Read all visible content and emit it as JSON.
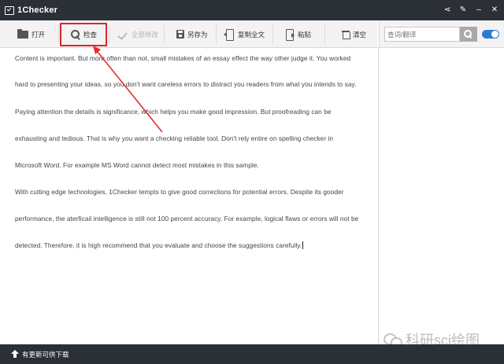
{
  "app": {
    "title": "1Checker"
  },
  "window_controls": [
    {
      "name": "share-icon",
      "glyph": "⋖"
    },
    {
      "name": "edit-icon",
      "glyph": "✎"
    },
    {
      "name": "minimize-icon",
      "glyph": "–"
    },
    {
      "name": "close-icon",
      "glyph": "✕"
    }
  ],
  "toolbar": {
    "open_label": "打开",
    "check_label": "检查",
    "accept_all_label": "全部修改",
    "save_as_label": "另存为",
    "copy_all_label": "复制全文",
    "paste_label": "粘贴",
    "clear_label": "清空"
  },
  "search": {
    "placeholder": "查词/翻译"
  },
  "editor": {
    "lines": [
      "Content is important. But more often than not, small mistakes of an essay effect the way other judge it. You worked",
      "hard to presenting your ideas, so you don't want careless errors to distract you readers from what you intends to say.",
      "Paying attention the details is significance, which helps you make good impression. But proofreading can be",
      "exhausting and tedious. That is why you want a checking reliable tool. Don't rely entire on spelling checker in",
      "Microsoft Word. For example MS Word cannot detect most mistakes in this sample.",
      "With cutting edge technologies, 1Checker tempts to give good corrections for potential errors. Despite its gooder",
      "performance, the aterficail intelligence is still not 100 percent accuracy. For example, logical flaws or errors will not be",
      "detected. Therefore, it is high    recommend that you evaluate and choose the suggestions carefully."
    ]
  },
  "watermark": {
    "text": "科研sci绘图"
  },
  "status": {
    "text": "有更新可供下载"
  },
  "colors": {
    "titlebar": "#2b2f36",
    "highlight": "#d9262b",
    "toggle": "#2d7ad6"
  }
}
